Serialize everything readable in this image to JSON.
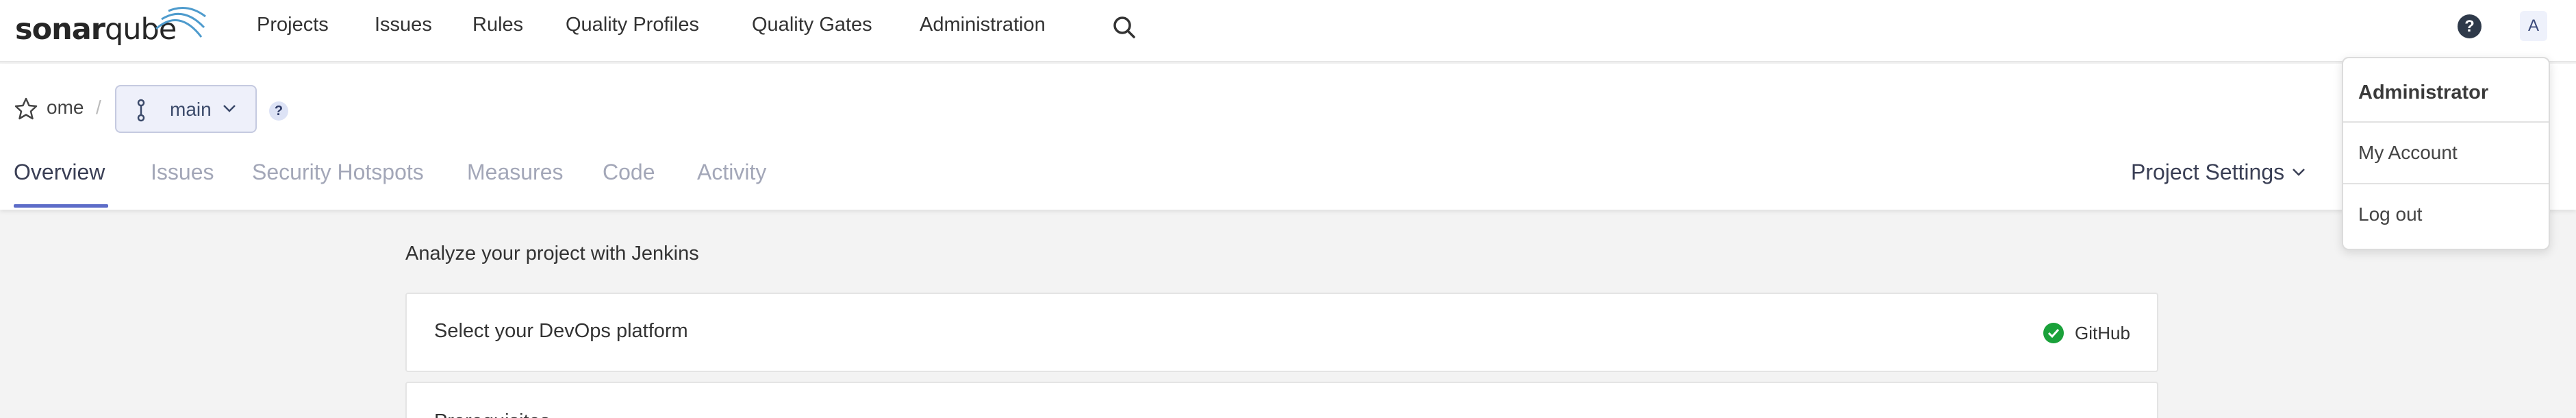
{
  "app": {
    "logo_text_bold": "sonar",
    "logo_text_light": "qube"
  },
  "nav": {
    "items": [
      {
        "label": "Projects"
      },
      {
        "label": "Issues"
      },
      {
        "label": "Rules"
      },
      {
        "label": "Quality Profiles"
      },
      {
        "label": "Quality Gates"
      },
      {
        "label": "Administration"
      }
    ],
    "search_icon": "search-icon",
    "help_icon": "help-icon",
    "help_text": "?",
    "avatar_letter": "A"
  },
  "project": {
    "name": "ome",
    "breadcrumb_sep": "/",
    "branch": "main",
    "branch_help": "?"
  },
  "tabs": [
    {
      "label": "Overview",
      "active": true
    },
    {
      "label": "Issues",
      "active": false
    },
    {
      "label": "Security Hotspots",
      "active": false
    },
    {
      "label": "Measures",
      "active": false
    },
    {
      "label": "Code",
      "active": false
    },
    {
      "label": "Activity",
      "active": false
    }
  ],
  "project_settings": "Project Settings",
  "content": {
    "title": "Analyze your project with Jenkins",
    "devops_card_title": "Select your DevOps platform",
    "devops_selected": "GitHub",
    "prereq_card_title": "Prerequisites"
  },
  "user_menu": {
    "header": "Administrator",
    "items": [
      {
        "label": "My Account"
      },
      {
        "label": "Log out"
      }
    ]
  },
  "colors": {
    "accent": "#5d6cc8",
    "success": "#1aa13a",
    "nav_text": "#333333"
  }
}
